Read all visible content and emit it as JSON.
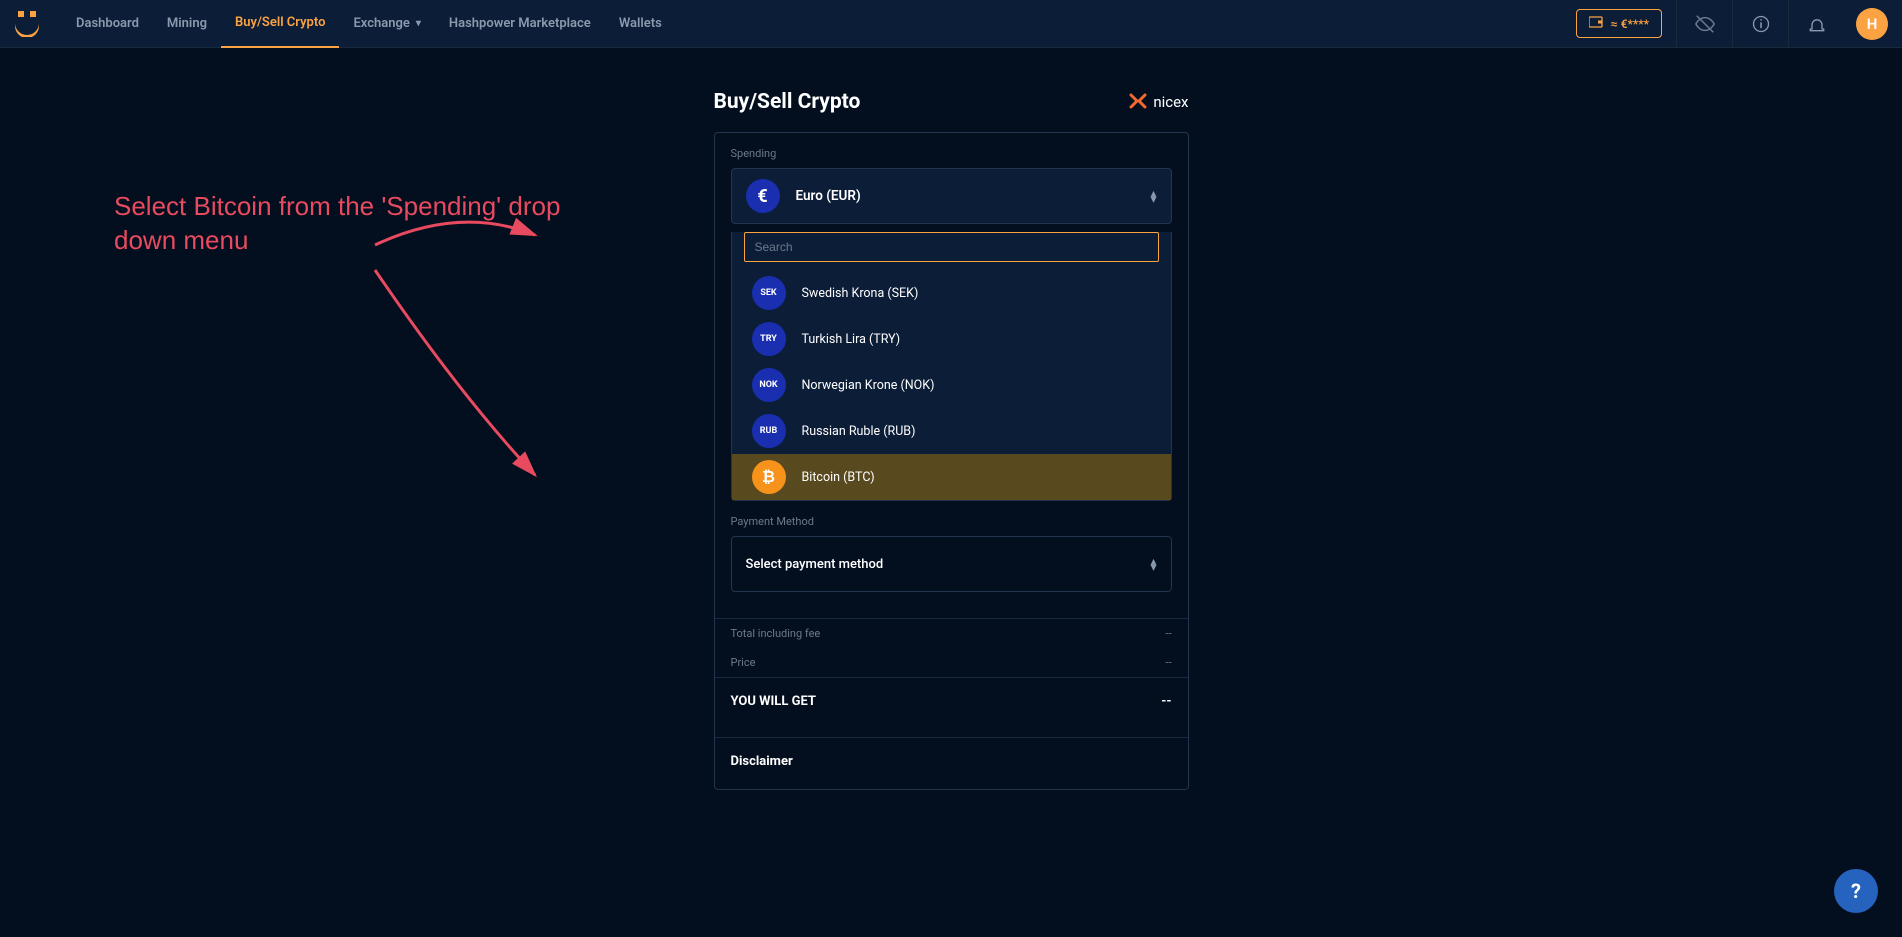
{
  "nav": {
    "items": [
      {
        "label": "Dashboard"
      },
      {
        "label": "Mining"
      },
      {
        "label": "Buy/Sell Crypto",
        "active": true
      },
      {
        "label": "Exchange",
        "chevron": true
      },
      {
        "label": "Hashpower Marketplace"
      },
      {
        "label": "Wallets"
      }
    ]
  },
  "header": {
    "balance": "≈ €****",
    "avatar_letter": "H"
  },
  "page": {
    "title": "Buy/Sell Crypto",
    "brand": "nicex"
  },
  "spending": {
    "label": "Spending",
    "selected_name": "Euro (EUR)",
    "selected_symbol": "€",
    "search_placeholder": "Search",
    "options": [
      {
        "code": "SEK",
        "name": "Swedish Krona (SEK)"
      },
      {
        "code": "TRY",
        "name": "Turkish Lira (TRY)"
      },
      {
        "code": "NOK",
        "name": "Norwegian Krone (NOK)"
      },
      {
        "code": "RUB",
        "name": "Russian Ruble (RUB)"
      },
      {
        "code": "₿",
        "name": "Bitcoin (BTC)",
        "btc": true,
        "hover": true
      }
    ]
  },
  "payment": {
    "label": "Payment Method",
    "placeholder": "Select payment method"
  },
  "summary": {
    "total_label": "Total including fee",
    "total_value": "--",
    "price_label": "Price",
    "price_value": "--",
    "get_label": "YOU WILL GET",
    "get_value": "--",
    "disclaimer_label": "Disclaimer"
  },
  "annotation": {
    "text": "Select Bitcoin from the 'Spending' drop down menu"
  },
  "help": "?"
}
